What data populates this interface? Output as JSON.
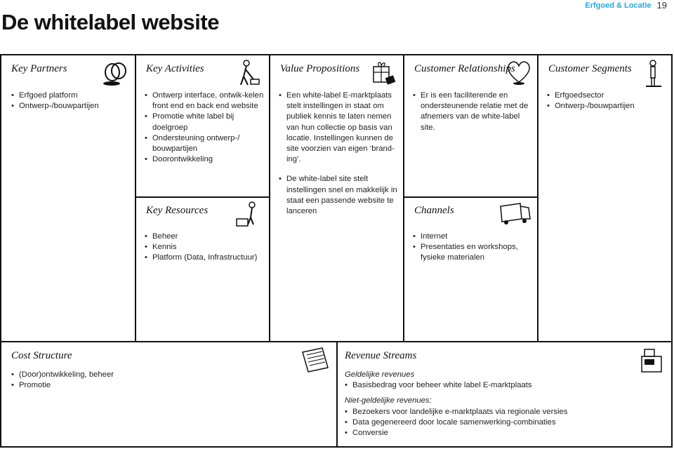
{
  "header": {
    "section": "Erfgoed & Locatie",
    "page": "19"
  },
  "title": "De whitelabel website",
  "key_partners": {
    "title": "Key Partners",
    "items": [
      "Erfgoed platform",
      "Ontwerp-/bouwpartijen"
    ]
  },
  "key_activities": {
    "title": "Key Activities",
    "items": [
      "Ontwerp interface, ontwik-kelen front end en back end website",
      "Promotie white label bij doelgroep",
      "Ondersteuning ontwerp-/ bouwpartijen",
      "Doorontwikkeling"
    ]
  },
  "key_resources": {
    "title": "Key Resources",
    "items": [
      "Beheer",
      "Kennis",
      "Platform (Data, Infrastructuur)"
    ]
  },
  "value_propositions": {
    "title": "Value Propositions",
    "items": [
      "Een white-label E-marktplaats stelt instellingen in staat om publiek kennis te laten nemen van hun collectie op basis van locatie. Instellingen kunnen de site voorzien van eigen ‘brand-ing’.",
      "De white-label site stelt instellingen snel en makkelijk in staat een passende website te lanceren"
    ]
  },
  "customer_relationships": {
    "title": "Customer Relationships",
    "items": [
      "Er is een faciliterende en ondersteunende relatie met de afnemers van de white-label site."
    ]
  },
  "channels": {
    "title": "Channels",
    "items": [
      "Internet",
      "Presentaties en workshops, fysieke materialen"
    ]
  },
  "customer_segments": {
    "title": "Customer Segments",
    "items": [
      "Erfgoedsector",
      "Ontwerp-/bouwpartijen"
    ]
  },
  "cost_structure": {
    "title": "Cost Structure",
    "items": [
      "(Door)ontwikkeling, beheer",
      "Promotie"
    ]
  },
  "revenue_streams": {
    "title": "Revenue Streams",
    "monetary_label": "Geldelijke revenues",
    "monetary": [
      "Basisbedrag voor beheer white label E-marktplaats"
    ],
    "non_monetary_label": "Niet-geldelijke revenues:",
    "non_monetary": [
      "Bezoekers voor landelijke e-marktplaats via regionale versies",
      "Data gegenereerd door locale samenwerking-combinaties",
      "Conversie"
    ]
  }
}
